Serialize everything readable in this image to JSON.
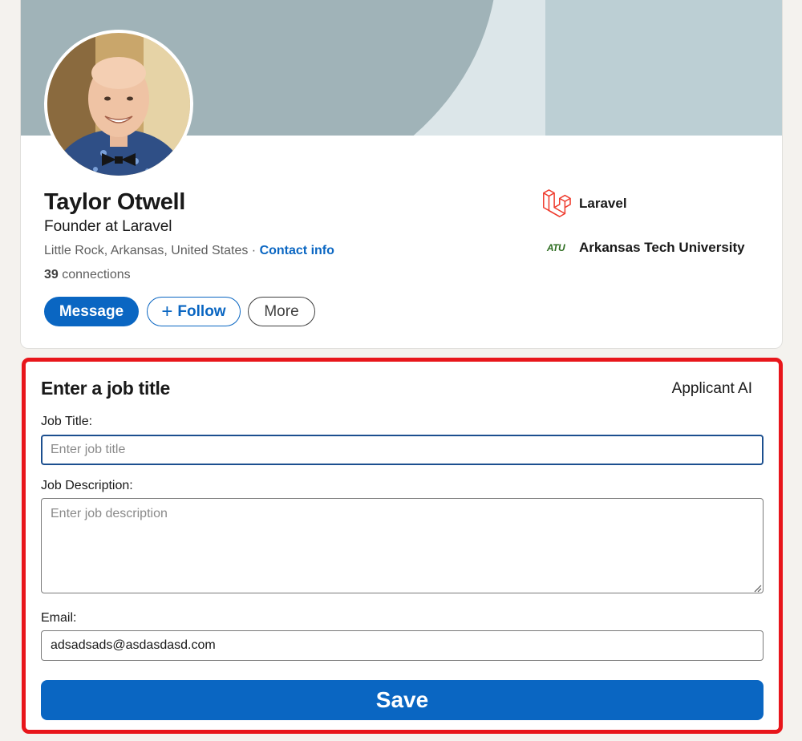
{
  "profile": {
    "name": "Taylor Otwell",
    "headline": "Founder at Laravel",
    "location": "Little Rock, Arkansas, United States",
    "separator": "·",
    "contact_info_label": "Contact info",
    "connections_count": "39",
    "connections_label": "connections",
    "buttons": {
      "message": "Message",
      "follow_plus": "+",
      "follow": "Follow",
      "more": "More"
    },
    "experience": [
      {
        "label": "Laravel",
        "icon": "laravel-logo-icon"
      },
      {
        "label": "Arkansas Tech University",
        "icon": "atu-logo-icon",
        "logo_text": "ATU"
      }
    ]
  },
  "form": {
    "title": "Enter a job title",
    "brand": "Applicant AI",
    "job_title_label": "Job Title:",
    "job_title_placeholder": "Enter job title",
    "job_title_value": "",
    "job_description_label": "Job Description:",
    "job_description_placeholder": "Enter job description",
    "email_label": "Email:",
    "email_value": "adsadsads@asdasdasd.com",
    "save_label": "Save"
  },
  "colors": {
    "accent": "#0a66c2",
    "highlight_border": "#e8161b",
    "laravel_red": "#ef3b2d",
    "atu_green": "#2b6b1e"
  }
}
